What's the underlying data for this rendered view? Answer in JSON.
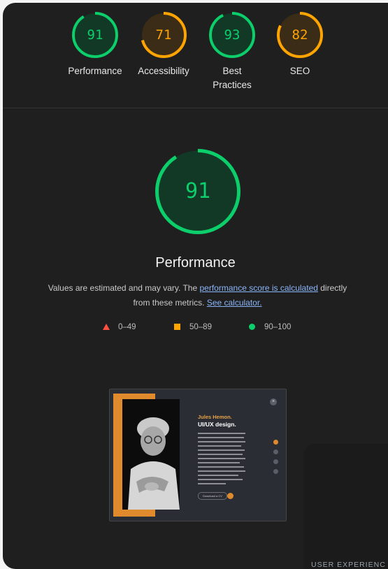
{
  "categories": [
    {
      "key": "performance",
      "score": "91",
      "label": "Performance",
      "fraction": 0.91,
      "color": "#0cce6b",
      "bg": "#123826"
    },
    {
      "key": "accessibility",
      "score": "71",
      "label": "Accessibility",
      "fraction": 0.71,
      "color": "#ffa400",
      "bg": "#3a2c17"
    },
    {
      "key": "best-practices",
      "score": "93",
      "label": "Best Practices",
      "fraction": 0.93,
      "color": "#0cce6b",
      "bg": "#123826"
    },
    {
      "key": "seo",
      "score": "82",
      "label": "SEO",
      "fraction": 0.82,
      "color": "#ffa400",
      "bg": "#3a2c17"
    }
  ],
  "main": {
    "score": "91",
    "fraction": 0.91,
    "title": "Performance",
    "desc_text1": "Values are estimated and may vary. The ",
    "desc_link1": "performance score is calculated",
    "desc_text2": " directly from these metrics. ",
    "desc_link2": "See calculator.",
    "color": "#0cce6b",
    "bg": "#123826"
  },
  "legend": [
    {
      "icon": "triangle-icon",
      "range": "0–49",
      "color": "#ff4e42"
    },
    {
      "icon": "square-icon",
      "range": "50–89",
      "color": "#ffa400"
    },
    {
      "icon": "circle-icon",
      "range": "90–100",
      "color": "#0cce6b"
    }
  ],
  "thumbnail": {
    "name": "Jules Hemon.",
    "role": "UI/UX design.",
    "button": "Download a CV"
  },
  "corner": {
    "text": "USER EXPERIENC"
  }
}
